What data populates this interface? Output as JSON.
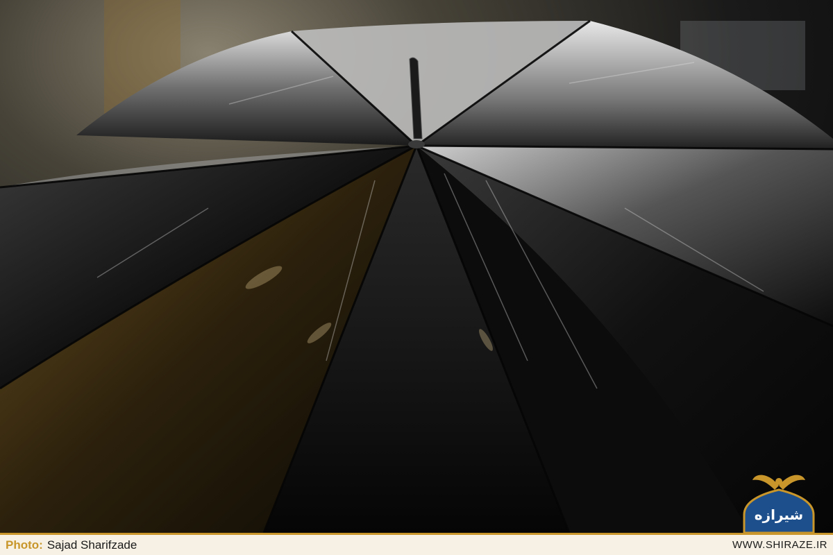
{
  "photo": {
    "subject": "umbrella"
  },
  "credit": {
    "prefix": "Photo:",
    "photographer": "Sajad Sharifzade"
  },
  "site": {
    "url": "WWW.SHIRAZE.IR"
  },
  "logo": {
    "text": "شیرازه",
    "colors": {
      "gold": "#c8962a",
      "blue": "#1d4f8c"
    }
  }
}
